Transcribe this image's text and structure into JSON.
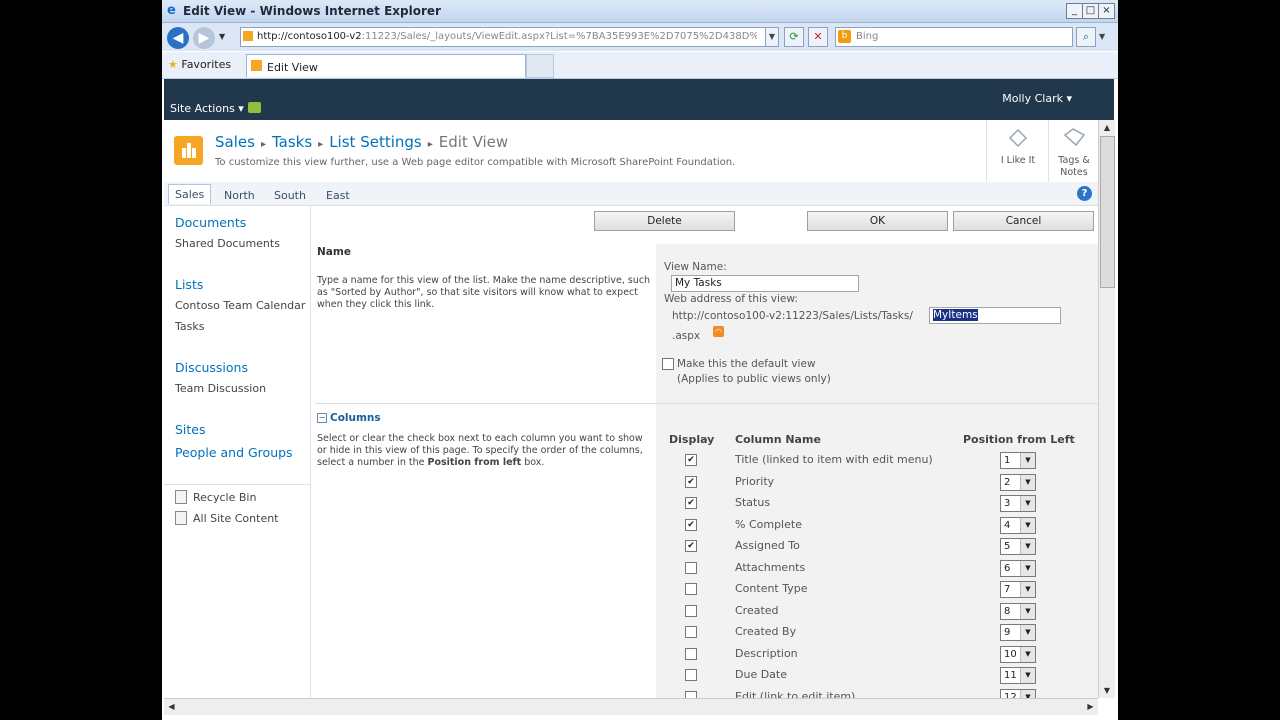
{
  "window": {
    "title": "Edit View - Windows Internet Explorer"
  },
  "browser": {
    "address": "http://contoso100-v2:11223/Sales/_layouts/ViewEdit.aspx?List=%7BA35E993E%2D7075%2D438D%2D9710%",
    "address_host": "http://contoso100-v2",
    "address_rest": ":11223/Sales/_layouts/ViewEdit.aspx?List=%7BA35E993E%2D7075%2D438D%2D9710%",
    "search_placeholder": "Bing",
    "favorites_label": "Favorites",
    "tab_label": "Edit View"
  },
  "sp": {
    "site_actions": "Site Actions",
    "user": "Molly Clark",
    "breadcrumb": [
      "Sales",
      "Tasks",
      "List Settings",
      "Edit View"
    ],
    "description": "To customize this view further, use a Web page editor compatible with Microsoft SharePoint Foundation.",
    "like_label": "I Like It",
    "tags_label_1": "Tags &",
    "tags_label_2": "Notes",
    "top_nav": [
      "Sales",
      "North",
      "South",
      "East"
    ],
    "help": "?"
  },
  "leftnav": {
    "documents": "Documents",
    "shared_documents": "Shared Documents",
    "lists": "Lists",
    "calendar": "Contoso Team Calendar",
    "tasks": "Tasks",
    "discussions": "Discussions",
    "team_discussion": "Team Discussion",
    "sites": "Sites",
    "people": "People and Groups",
    "recycle": "Recycle Bin",
    "all_content": "All Site Content"
  },
  "buttons": {
    "delete": "Delete",
    "ok": "OK",
    "cancel": "Cancel"
  },
  "name_section": {
    "heading": "Name",
    "help": "Type a name for this view of the list. Make the name descriptive, such as \"Sorted by Author\", so that site visitors will know what to expect when they click this link.",
    "view_name_label": "View Name:",
    "view_name_value": "My Tasks",
    "web_address_label": "Web address of this view:",
    "web_address_prefix": "http://contoso100-v2:11223/Sales/Lists/Tasks/",
    "web_address_value": "MyItems",
    "aspx": ".aspx",
    "default_label": "Make this the default view",
    "default_note": "(Applies to public views only)"
  },
  "columns_section": {
    "heading": "Columns",
    "help_1": "Select or clear the check box next to each column you want to show or hide in this view of this page. To specify the order of the columns, select a number in the ",
    "help_bold": "Position from left",
    "help_2": " box.",
    "hdr_display": "Display",
    "hdr_name": "Column Name",
    "hdr_position": "Position from Left",
    "rows": [
      {
        "name": "Title (linked to item with edit menu)",
        "checked": true,
        "pos": "1"
      },
      {
        "name": "Priority",
        "checked": true,
        "pos": "2"
      },
      {
        "name": "Status",
        "checked": true,
        "pos": "3"
      },
      {
        "name": "% Complete",
        "checked": true,
        "pos": "4"
      },
      {
        "name": "Assigned To",
        "checked": true,
        "pos": "5"
      },
      {
        "name": "Attachments",
        "checked": false,
        "pos": "6"
      },
      {
        "name": "Content Type",
        "checked": false,
        "pos": "7"
      },
      {
        "name": "Created",
        "checked": false,
        "pos": "8"
      },
      {
        "name": "Created By",
        "checked": false,
        "pos": "9"
      },
      {
        "name": "Description",
        "checked": false,
        "pos": "10"
      },
      {
        "name": "Due Date",
        "checked": false,
        "pos": "11"
      },
      {
        "name": "Edit (link to edit item)",
        "checked": false,
        "pos": "12"
      }
    ]
  }
}
